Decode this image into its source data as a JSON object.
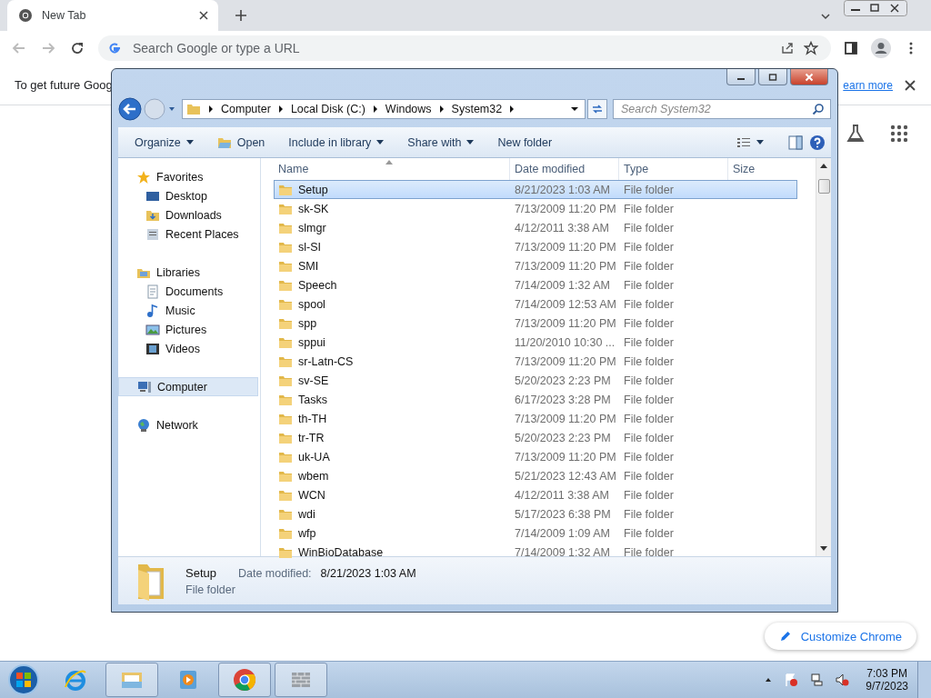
{
  "browser": {
    "tab": {
      "title": "New Tab",
      "selected": true
    },
    "omnibox": {
      "placeholder": "Search Google or type a URL"
    },
    "infobar": {
      "text": "To get future Goog",
      "link": "earn more"
    },
    "customize_button": "Customize Chrome"
  },
  "explorer": {
    "breadcrumbs": [
      "Computer",
      "Local Disk (C:)",
      "Windows",
      "System32"
    ],
    "search": {
      "placeholder": "Search System32"
    },
    "toolbar": [
      {
        "label": "Organize",
        "kind": "menu"
      },
      {
        "label": "Open",
        "kind": "open"
      },
      {
        "label": "Include in library",
        "kind": "menu"
      },
      {
        "label": "Share with",
        "kind": "menu"
      },
      {
        "label": "New folder",
        "kind": "plain"
      }
    ],
    "nav": [
      {
        "label": "Favorites",
        "kind": "star",
        "selected": false,
        "children": [
          {
            "label": "Desktop",
            "kind": "desktop",
            "selected": false
          },
          {
            "label": "Downloads",
            "kind": "folder",
            "selected": false
          },
          {
            "label": "Recent Places",
            "kind": "recent",
            "selected": false
          }
        ]
      },
      {
        "label": "Libraries",
        "kind": "library",
        "selected": false,
        "children": [
          {
            "label": "Documents",
            "kind": "doc",
            "selected": false
          },
          {
            "label": "Music",
            "kind": "music",
            "selected": false
          },
          {
            "label": "Pictures",
            "kind": "pic",
            "selected": false
          },
          {
            "label": "Videos",
            "kind": "video",
            "selected": false
          }
        ]
      },
      {
        "label": "Computer",
        "kind": "computer",
        "selected": true
      },
      {
        "label": "Network",
        "kind": "network",
        "selected": false
      }
    ],
    "columns": [
      "Name",
      "Date modified",
      "Type",
      "Size"
    ],
    "rows": [
      {
        "name": "Setup",
        "date": "8/21/2023 1:03 AM",
        "type": "File folder",
        "selected": true
      },
      {
        "name": "sk-SK",
        "date": "7/13/2009 11:20 PM",
        "type": "File folder",
        "selected": false
      },
      {
        "name": "slmgr",
        "date": "4/12/2011 3:38 AM",
        "type": "File folder",
        "selected": false
      },
      {
        "name": "sl-SI",
        "date": "7/13/2009 11:20 PM",
        "type": "File folder",
        "selected": false
      },
      {
        "name": "SMI",
        "date": "7/13/2009 11:20 PM",
        "type": "File folder",
        "selected": false
      },
      {
        "name": "Speech",
        "date": "7/14/2009 1:32 AM",
        "type": "File folder",
        "selected": false
      },
      {
        "name": "spool",
        "date": "7/14/2009 12:53 AM",
        "type": "File folder",
        "selected": false
      },
      {
        "name": "spp",
        "date": "7/13/2009 11:20 PM",
        "type": "File folder",
        "selected": false
      },
      {
        "name": "sppui",
        "date": "11/20/2010 10:30 ...",
        "type": "File folder",
        "selected": false
      },
      {
        "name": "sr-Latn-CS",
        "date": "7/13/2009 11:20 PM",
        "type": "File folder",
        "selected": false
      },
      {
        "name": "sv-SE",
        "date": "5/20/2023 2:23 PM",
        "type": "File folder",
        "selected": false
      },
      {
        "name": "Tasks",
        "date": "6/17/2023 3:28 PM",
        "type": "File folder",
        "selected": false
      },
      {
        "name": "th-TH",
        "date": "7/13/2009 11:20 PM",
        "type": "File folder",
        "selected": false
      },
      {
        "name": "tr-TR",
        "date": "5/20/2023 2:23 PM",
        "type": "File folder",
        "selected": false
      },
      {
        "name": "uk-UA",
        "date": "7/13/2009 11:20 PM",
        "type": "File folder",
        "selected": false
      },
      {
        "name": "wbem",
        "date": "5/21/2023 12:43 AM",
        "type": "File folder",
        "selected": false
      },
      {
        "name": "WCN",
        "date": "4/12/2011 3:38 AM",
        "type": "File folder",
        "selected": false
      },
      {
        "name": "wdi",
        "date": "5/17/2023 6:38 PM",
        "type": "File folder",
        "selected": false
      },
      {
        "name": "wfp",
        "date": "7/14/2009 1:09 AM",
        "type": "File folder",
        "selected": false
      },
      {
        "name": "WinBioDatabase",
        "date": "7/14/2009 1:32 AM",
        "type": "File folder",
        "selected": false
      }
    ],
    "details": {
      "name": "Setup",
      "date_label": "Date modified:",
      "date": "8/21/2023 1:03 AM",
      "type": "File folder"
    }
  },
  "taskbar": {
    "apps": [
      {
        "kind": "ie",
        "active": false
      },
      {
        "kind": "explorer",
        "active": true
      },
      {
        "kind": "media",
        "active": false
      },
      {
        "kind": "chrome",
        "active": true
      },
      {
        "kind": "wall",
        "active": true
      }
    ],
    "time": "7:03 PM",
    "date": "9/7/2023"
  }
}
